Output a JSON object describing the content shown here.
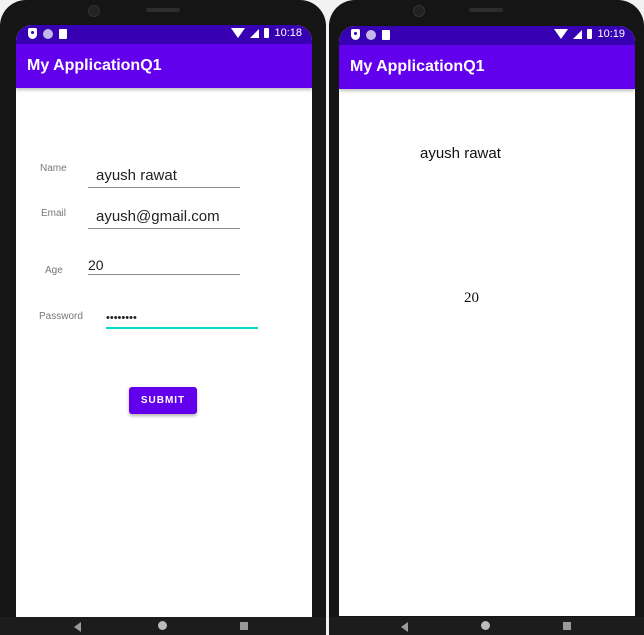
{
  "left_screen": {
    "status": {
      "time": "10:18"
    },
    "app_bar": {
      "title": "My ApplicationQ1"
    },
    "form": {
      "name_label": "Name",
      "name_value": "ayush rawat",
      "email_label": "Email",
      "email_value": "ayush@gmail.com",
      "age_label": "Age",
      "age_value": "20",
      "password_label": "Password",
      "password_value": "••••••••",
      "submit_label": "SUBMIT"
    }
  },
  "right_screen": {
    "status": {
      "time": "10:19"
    },
    "app_bar": {
      "title": "My ApplicationQ1"
    },
    "output": {
      "name_text": "ayush rawat",
      "age_text": "20"
    }
  },
  "colors": {
    "status_bar": "#3700b3",
    "primary": "#6200ee",
    "accent": "#03dac5"
  },
  "icons": [
    "shield-icon",
    "circle-status-icon",
    "sim-card-icon",
    "wifi-icon",
    "signal-icon",
    "battery-icon",
    "back-icon",
    "home-icon",
    "recents-icon"
  ]
}
